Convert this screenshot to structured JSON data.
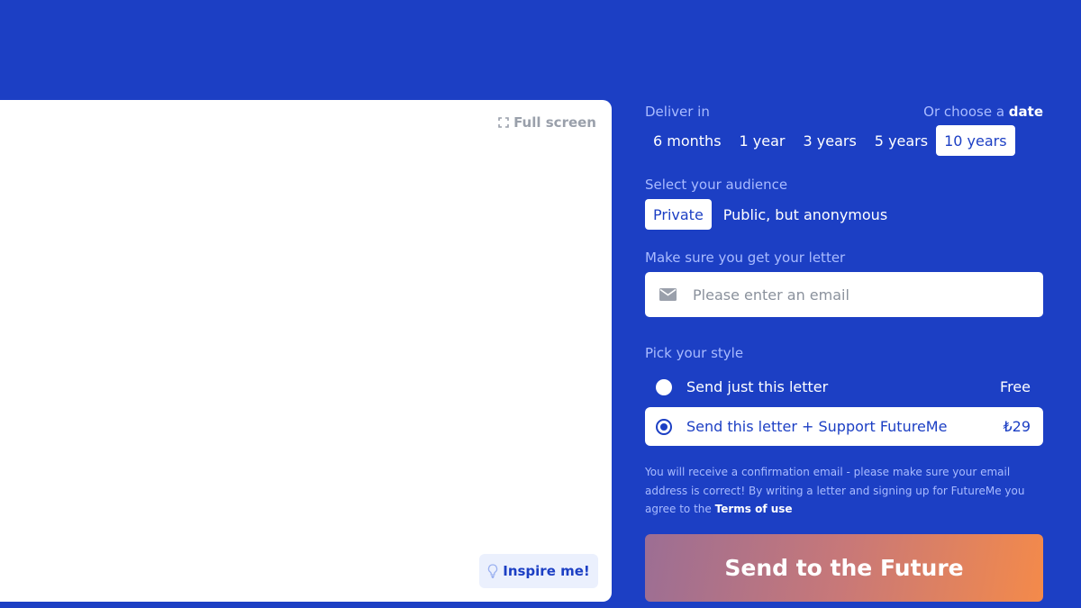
{
  "editor": {
    "fullscreen_label": "Full screen",
    "inspire_label": "Inspire me!"
  },
  "delivery": {
    "label": "Deliver in",
    "choose_prefix": "Or choose a",
    "choose_link": "date",
    "options": [
      "6 months",
      "1 year",
      "3 years",
      "5 years",
      "10 years"
    ],
    "selected": "10 years"
  },
  "audience": {
    "label": "Select your audience",
    "options": [
      "Private",
      "Public, but anonymous"
    ],
    "selected": "Private"
  },
  "email": {
    "label": "Make sure you get your letter",
    "value": "",
    "placeholder": "Please enter an email"
  },
  "style": {
    "label": "Pick your style",
    "options": [
      {
        "text": "Send just this letter",
        "price": "Free"
      },
      {
        "text": "Send this letter + Support FutureMe",
        "price": "₺29"
      }
    ],
    "selected_index": 1
  },
  "notice": {
    "text": "You will receive a confirmation email - please make sure your email address is correct! By writing a letter and signing up for FutureMe you agree to the",
    "terms_link": "Terms of use"
  },
  "submit": {
    "label": "Send to the Future"
  },
  "colors": {
    "background": "#1c3fc4",
    "muted_label": "#a9bbff",
    "gradient_start": "#9c6e94",
    "gradient_end": "#f48a4a"
  },
  "icons": {
    "fullscreen": "fullscreen-icon",
    "inspire": "lightbulb-icon",
    "email": "envelope-icon"
  }
}
